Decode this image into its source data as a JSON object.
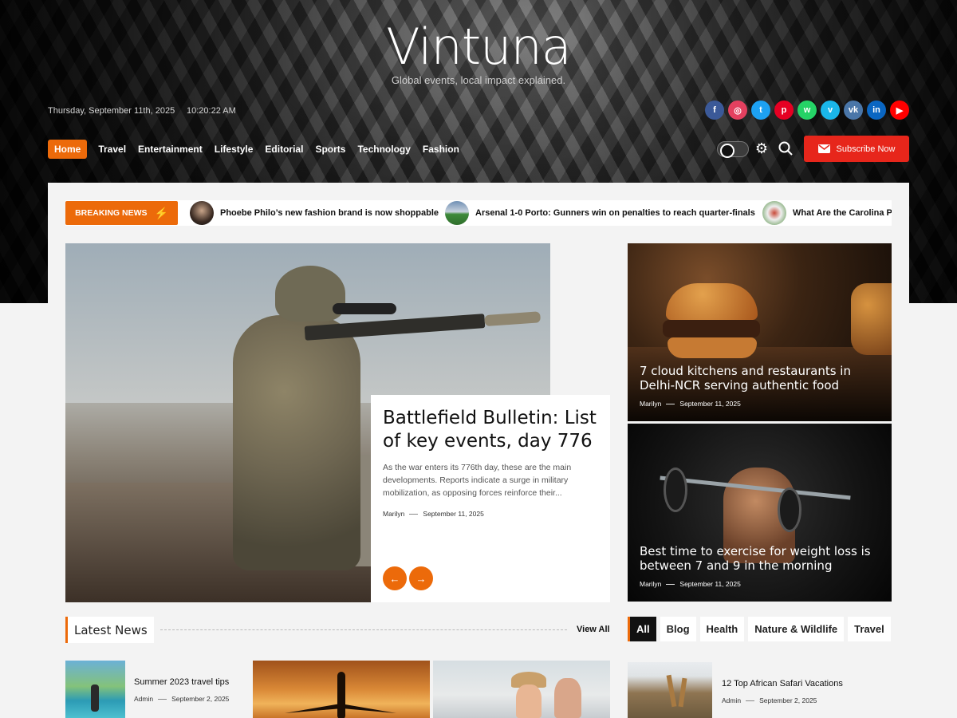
{
  "site": {
    "title": "Vintuna",
    "tagline": "Global events, local impact explained."
  },
  "topbar": {
    "date": "Thursday, September 11th, 2025",
    "time": "10:20:22 AM"
  },
  "social": [
    {
      "name": "facebook",
      "glyph": "f",
      "color": "#3b5998"
    },
    {
      "name": "instagram",
      "glyph": "◎",
      "color": "#e4405f"
    },
    {
      "name": "twitter",
      "glyph": "t",
      "color": "#1da1f2"
    },
    {
      "name": "pinterest",
      "glyph": "p",
      "color": "#e60023"
    },
    {
      "name": "whatsapp",
      "glyph": "w",
      "color": "#25d366"
    },
    {
      "name": "vimeo",
      "glyph": "v",
      "color": "#1ab7ea"
    },
    {
      "name": "vk",
      "glyph": "vk",
      "color": "#4a76a8"
    },
    {
      "name": "linkedin",
      "glyph": "in",
      "color": "#0a66c2"
    },
    {
      "name": "youtube",
      "glyph": "▶",
      "color": "#ff0000"
    }
  ],
  "nav": [
    "Home",
    "Travel",
    "Entertainment",
    "Lifestyle",
    "Editorial",
    "Sports",
    "Technology",
    "Fashion"
  ],
  "subscribe_label": "Subscribe Now",
  "accent_color": "#ec6a0a",
  "breaking": {
    "label": "BREAKING NEWS",
    "items": [
      "Phoebe Philo’s new fashion brand is now shoppable",
      "Arsenal 1-0 Porto: Gunners win on penalties to reach quarter-finals",
      "What Are the Carolina P"
    ]
  },
  "feature": {
    "title": "Battlefield Bulletin: List of key events, day 776",
    "excerpt": "As the war enters its 776th day, these are the main developments. Reports indicate a surge in military mobilization, as opposing forces reinforce their...",
    "author": "Marilyn",
    "date": "September 11, 2025",
    "prev": "←",
    "next": "→"
  },
  "side": [
    {
      "title": "7 cloud kitchens and restaurants in Delhi-NCR serving authentic food",
      "author": "Marilyn",
      "date": "September 11, 2025"
    },
    {
      "title": "Best time to exercise for weight loss is between 7 and 9 in the morning",
      "author": "Marilyn",
      "date": "September 11, 2025"
    }
  ],
  "latest": {
    "heading": "Latest News",
    "view_all": "View All",
    "items": [
      {
        "title": "Summer 2023 travel tips",
        "author": "Admin",
        "date": "September 2, 2025"
      }
    ]
  },
  "tabs": [
    "All",
    "Blog",
    "Health",
    "Nature & Wildlife",
    "Travel"
  ],
  "tab_posts": [
    {
      "title": "12 Top African Safari Vacations",
      "author": "Admin",
      "date": "September 2, 2025"
    }
  ]
}
